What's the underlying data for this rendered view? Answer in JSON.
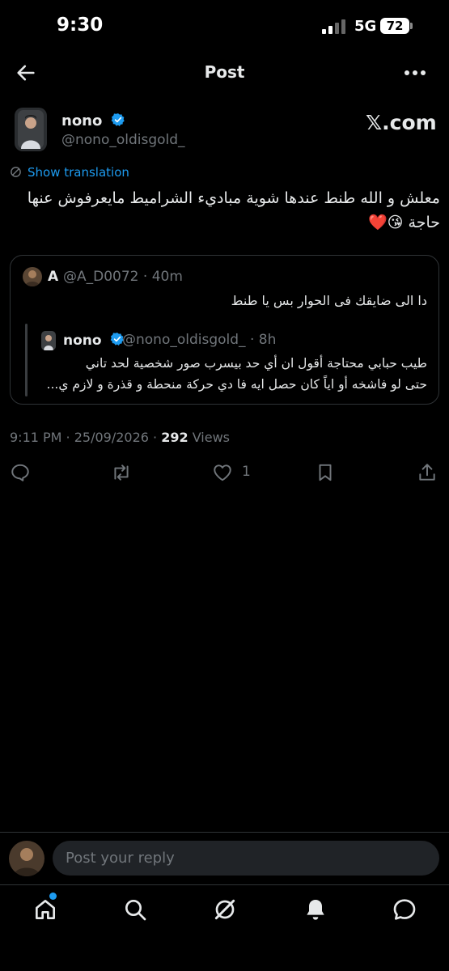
{
  "status_bar": {
    "time": "9:30",
    "network": "5G",
    "battery": "72"
  },
  "header": {
    "title": "Post"
  },
  "post": {
    "author_name": "nono",
    "author_handle": "@nono_oldisgold_",
    "watermark": "𝕏.com",
    "translation_label": "Show translation",
    "text": "معلش و الله طنط عندها شوية مباديء الشراميط مايعرفوش عنها حاجة 😘❤️",
    "timestamp": "9:11 PM · 25/09/2026 · ",
    "views_count": "292",
    "views_label": " Views",
    "like_count": "1"
  },
  "quote": {
    "name": "A",
    "handle_time": "@A_D0072 · 40m",
    "text": "دا الى ضايقك فى الحوار بس يا طنط",
    "inner": {
      "name": "nono",
      "handle_time": "@nono_oldisgold_ · 8h",
      "lines": [
        "طيب حبابي محتاجة أقول ان أي حد بيسرب صور شخصية لحد تاني",
        "حتى لو فاشخه أو اياً كان حصل ايه فا دي حركة منحطة و قذرة و لازم ي..."
      ]
    }
  },
  "reply": {
    "placeholder": "Post your reply"
  },
  "colors": {
    "accent": "#1d9bf0",
    "background": "#000000",
    "muted": "#71767b",
    "like": "#e8334b"
  },
  "icons": [
    "back-arrow-icon",
    "more-icon",
    "verified-icon",
    "translate-icon",
    "reply-icon",
    "repost-icon",
    "like-icon",
    "bookmark-icon",
    "share-icon",
    "home-icon",
    "search-icon",
    "grok-icon",
    "notifications-icon",
    "messages-icon"
  ]
}
